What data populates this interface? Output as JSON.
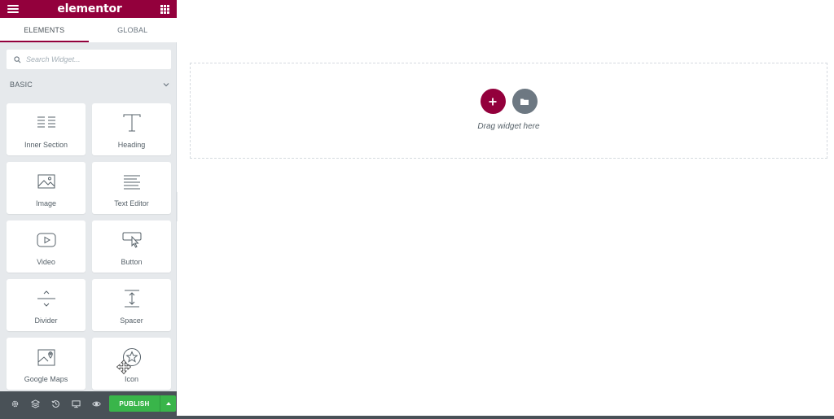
{
  "app": {
    "logo": "elementor",
    "accent_color": "#93003c"
  },
  "tabs": [
    {
      "label": "ELEMENTS",
      "active": true
    },
    {
      "label": "GLOBAL",
      "active": false
    }
  ],
  "search": {
    "placeholder": "Search Widget..."
  },
  "category": {
    "label": "BASIC",
    "expanded": true
  },
  "widgets": [
    {
      "label": "Inner Section",
      "icon": "inner-section-icon"
    },
    {
      "label": "Heading",
      "icon": "heading-icon"
    },
    {
      "label": "Image",
      "icon": "image-icon"
    },
    {
      "label": "Text Editor",
      "icon": "text-editor-icon"
    },
    {
      "label": "Video",
      "icon": "video-icon"
    },
    {
      "label": "Button",
      "icon": "button-icon"
    },
    {
      "label": "Divider",
      "icon": "divider-icon"
    },
    {
      "label": "Spacer",
      "icon": "spacer-icon"
    },
    {
      "label": "Google Maps",
      "icon": "google-maps-icon"
    },
    {
      "label": "Icon",
      "icon": "star-icon"
    }
  ],
  "footer": {
    "icons": [
      "settings-icon",
      "navigator-icon",
      "history-icon",
      "responsive-icon",
      "preview-icon"
    ],
    "publish_label": "PUBLISH",
    "publish_color": "#39b54a"
  },
  "canvas": {
    "dropzone_text": "Drag widget here"
  }
}
